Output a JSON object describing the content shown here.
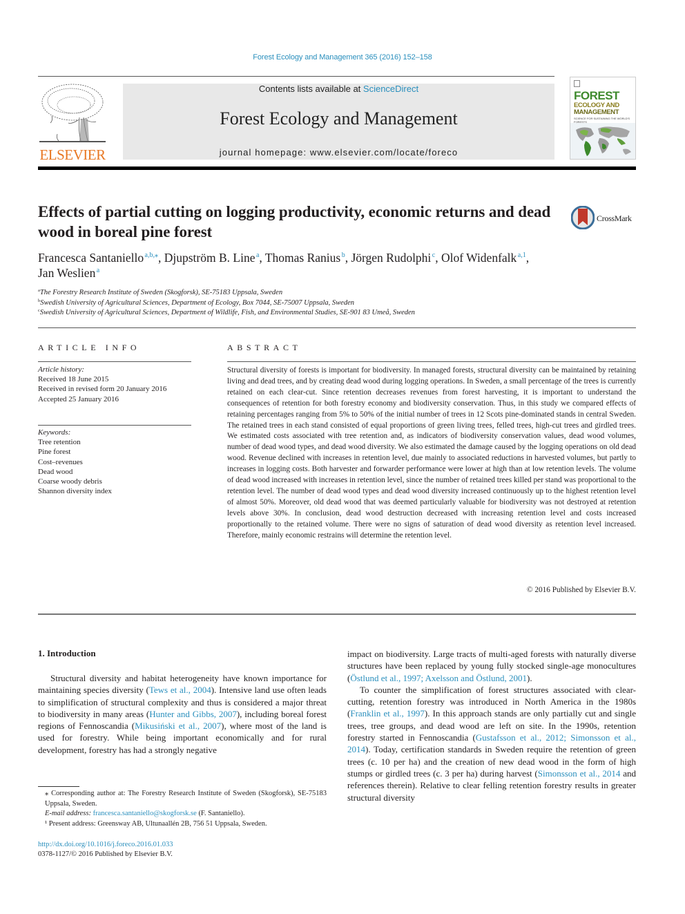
{
  "header": {
    "journal_ref": "Forest Ecology and Management 365 (2016) 152–158",
    "contents_prefix": "Contents lists available at ",
    "contents_link": "ScienceDirect",
    "journal_title": "Forest Ecology and Management",
    "homepage_line": "journal homepage: www.elsevier.com/locate/foreco",
    "publisher_logo": "ELSEVIER",
    "cover": {
      "line1": "FOREST",
      "line2": "ECOLOGY AND",
      "line3": "MANAGEMENT",
      "subtitle": "SCIENCE FOR SUSTAINING THE WORLD'S FORESTS"
    },
    "colors": {
      "link": "#2a8fbd",
      "elsevier_orange": "#e87722",
      "masthead_bg": "#e8e8e8"
    }
  },
  "article": {
    "title": "Effects of partial cutting on logging productivity, economic returns and dead wood in boreal pine forest",
    "crossmark_label": "CrossMark",
    "authors": [
      {
        "name": "Francesca Santaniello",
        "sup": "a,b,⁎"
      },
      {
        "name": "Djupström B. Line",
        "sup": "a"
      },
      {
        "name": "Thomas Ranius",
        "sup": "b"
      },
      {
        "name": "Jörgen Rudolphi",
        "sup": "c"
      },
      {
        "name": "Olof Widenfalk",
        "sup": "a,1"
      },
      {
        "name": "Jan Weslien",
        "sup": "a"
      }
    ],
    "affiliations": [
      {
        "key": "a",
        "text": "The Forestry Research Institute of Sweden (Skogforsk), SE-75183 Uppsala, Sweden"
      },
      {
        "key": "b",
        "text": "Swedish University of Agricultural Sciences, Department of Ecology, Box 7044, SE-75007 Uppsala, Sweden"
      },
      {
        "key": "c",
        "text": "Swedish University of Agricultural Sciences, Department of Wildlife, Fish, and Environmental Studies, SE-901 83 Umeå, Sweden"
      }
    ]
  },
  "article_info": {
    "heading": "ARTICLE INFO",
    "history_label": "Article history:",
    "history": [
      "Received 18 June 2015",
      "Received in revised form 20 January 2016",
      "Accepted 25 January 2016"
    ],
    "keywords_label": "Keywords:",
    "keywords": [
      "Tree retention",
      "Pine forest",
      "Cost–revenues",
      "Dead wood",
      "Coarse woody debris",
      "Shannon diversity index"
    ]
  },
  "abstract": {
    "heading": "ABSTRACT",
    "text": "Structural diversity of forests is important for biodiversity. In managed forests, structural diversity can be maintained by retaining living and dead trees, and by creating dead wood during logging operations. In Sweden, a small percentage of the trees is currently retained on each clear-cut. Since retention decreases revenues from forest harvesting, it is important to understand the consequences of retention for both forestry economy and biodiversity conservation. Thus, in this study we compared effects of retaining percentages ranging from 5% to 50% of the initial number of trees in 12 Scots pine-dominated stands in central Sweden. The retained trees in each stand consisted of equal proportions of green living trees, felled trees, high-cut trees and girdled trees. We estimated costs associated with tree retention and, as indicators of biodiversity conservation values, dead wood volumes, number of dead wood types, and dead wood diversity. We also estimated the damage caused by the logging operations on old dead wood. Revenue declined with increases in retention level, due mainly to associated reductions in harvested volumes, but partly to increases in logging costs. Both harvester and forwarder performance were lower at high than at low retention levels. The volume of dead wood increased with increases in retention level, since the number of retained trees killed per stand was proportional to the retention level. The number of dead wood types and dead wood diversity increased continuously up to the highest retention level of almost 50%. Moreover, old dead wood that was deemed particularly valuable for biodiversity was not destroyed at retention levels above 30%. In conclusion, dead wood destruction decreased with increasing retention level and costs increased proportionally to the retained volume. There were no signs of saturation of dead wood diversity as retention level increased. Therefore, mainly economic restrains will determine the retention level.",
    "copyright": "© 2016 Published by Elsevier B.V."
  },
  "body": {
    "intro_heading": "1. Introduction",
    "left_p1": [
      {
        "t": "Structural diversity and habitat heterogeneity have known importance for maintaining species diversity ("
      },
      {
        "t": "Tews et al., 2004",
        "link": true
      },
      {
        "t": "). Intensive land use often leads to simplification of structural complexity and thus is considered a major threat to biodiversity in many areas ("
      },
      {
        "t": "Hunter and Gibbs, 2007",
        "link": true
      },
      {
        "t": "), including boreal forest regions of Fennoscandia ("
      },
      {
        "t": "Mikusiński et al., 2007",
        "link": true
      },
      {
        "t": "), where most of the land is used for forestry. While being important economically and for rural development, forestry has had a strongly negative"
      }
    ],
    "right_p1": [
      {
        "t": "impact on biodiversity. Large tracts of multi-aged forests with naturally diverse structures have been replaced by young fully stocked single-age monocultures ("
      },
      {
        "t": "Östlund et al., 1997; Axelsson and Östlund, 2001",
        "link": true
      },
      {
        "t": ")."
      }
    ],
    "right_p2": [
      {
        "t": "To counter the simplification of forest structures associated with clear-cutting, retention forestry was introduced in North America in the 1980s ("
      },
      {
        "t": "Franklin et al., 1997",
        "link": true
      },
      {
        "t": "). In this approach stands are only partially cut and single trees, tree groups, and dead wood are left on site. In the 1990s, retention forestry started in Fennoscandia ("
      },
      {
        "t": "Gustafsson et al., 2012; Simonsson et al., 2014",
        "link": true
      },
      {
        "t": "). Today, certification standards in Sweden require the retention of green trees (c. 10 per ha) and the creation of new dead wood in the form of high stumps or girdled trees (c. 3 per ha) during harvest ("
      },
      {
        "t": "Simonsson et al., 2014",
        "link": true
      },
      {
        "t": " and references therein). Relative to clear felling retention forestry results in greater structural diversity"
      }
    ]
  },
  "footnotes": {
    "corresponding": "⁎ Corresponding author at: The Forestry Research Institute of Sweden (Skogforsk), SE-75183 Uppsala, Sweden.",
    "email_label": "E-mail address: ",
    "email": "francesca.santaniello@skogforsk.se",
    "email_suffix": " (F. Santaniello).",
    "present_address": "¹ Present address: Greensway AB, Ultunaallén 2B, 756 51 Uppsala, Sweden.",
    "doi": "http://dx.doi.org/10.1016/j.foreco.2016.01.033",
    "issn": "0378-1127/© 2016 Published by Elsevier B.V."
  }
}
